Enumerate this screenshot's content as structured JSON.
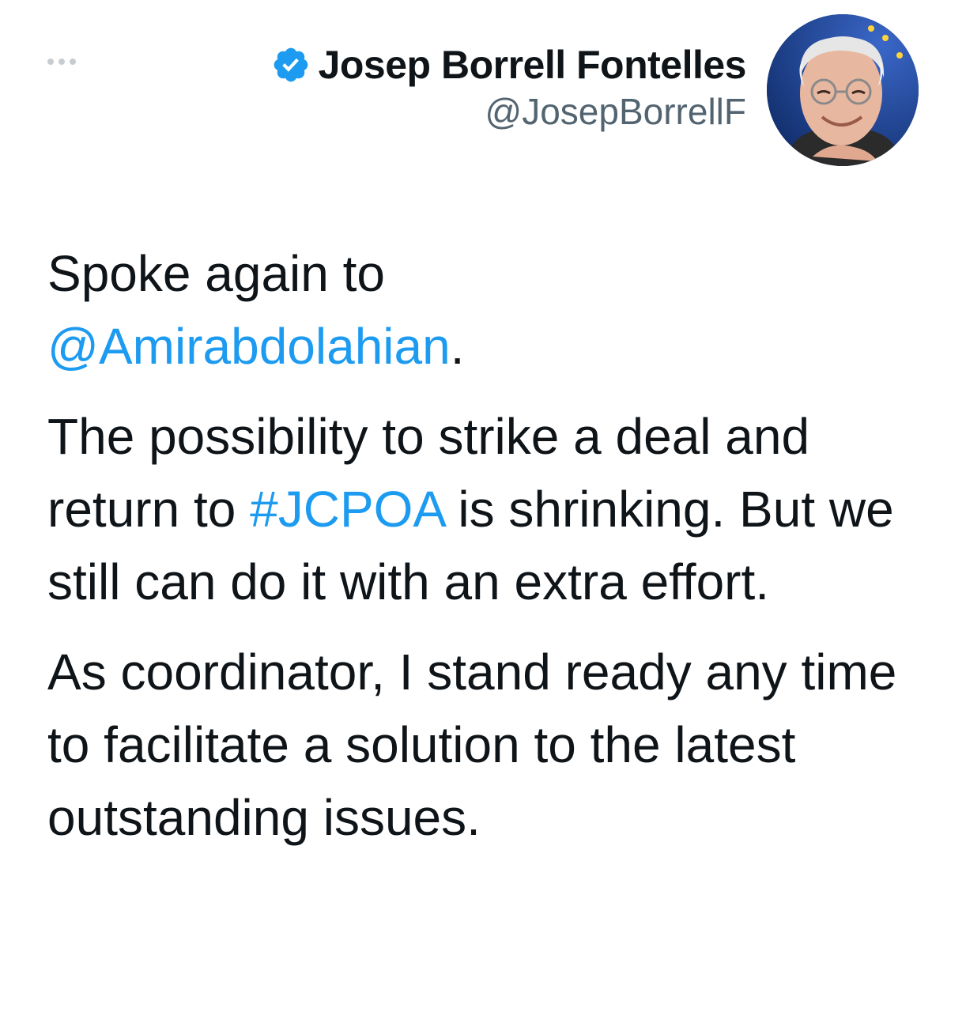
{
  "header": {
    "more_icon": "more-horizontal-icon",
    "display_name": "Josep Borrell Fontelles",
    "handle": "@JosepBorrellF",
    "verified_icon": "verified-badge-icon",
    "avatar": "profile-photo"
  },
  "colors": {
    "link": "#1d9bf0",
    "text": "#0f1419",
    "secondary": "#536471",
    "verified": "#1d9bf0"
  },
  "tweet": {
    "p1_text": "Spoke again to",
    "p1_mention": "@Amirabdolahian",
    "p1_after": ".",
    "p2_text_1": "The possibility to strike a deal and return to",
    "p2_hashtag": "#JCPOA",
    "p2_text_2": "is shrinking. But we still can do it with an extra effort.",
    "p3_text": "As coordinator, I stand ready any time to facilitate a solution to the latest outstanding issues."
  }
}
